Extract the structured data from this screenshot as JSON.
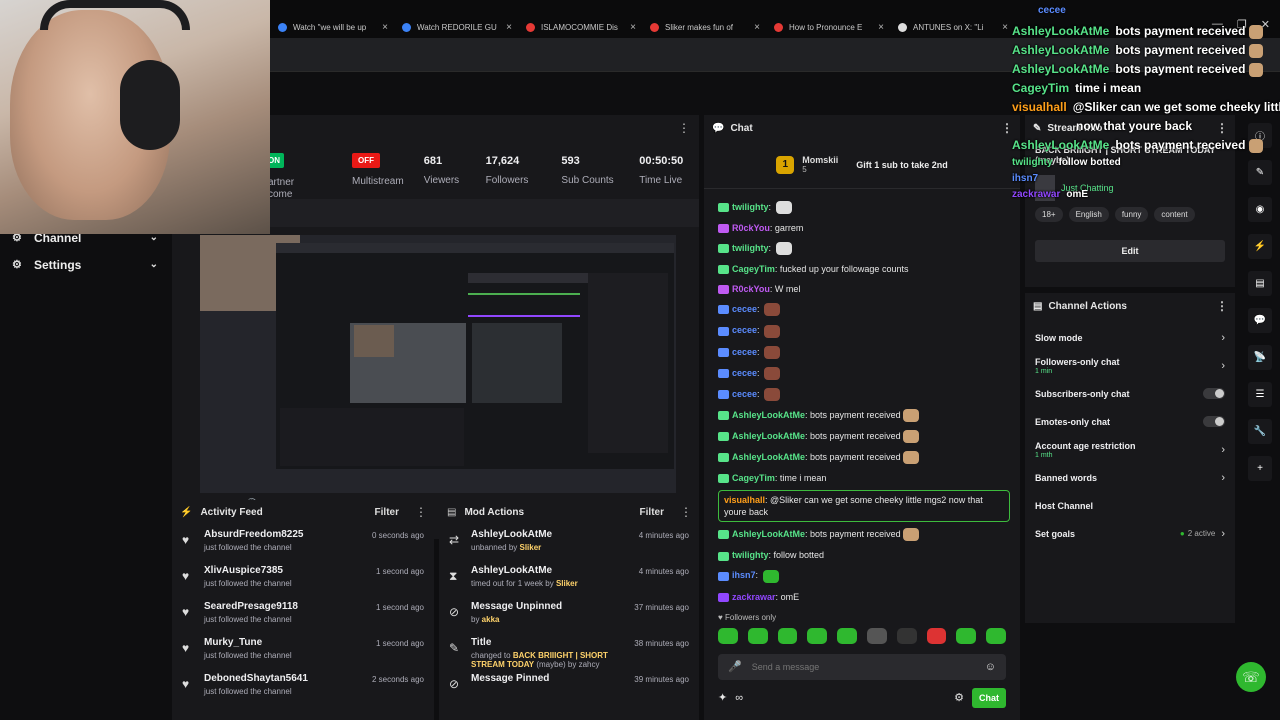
{
  "colors": {
    "accent": "#2fb82f",
    "live": "#00b55a",
    "off": "#e91916",
    "hype": "#d9a400"
  },
  "browser_tabs": [
    {
      "label": "Watch \"we will be up",
      "color": "#3b82f6"
    },
    {
      "label": "Watch REDORILE GU",
      "color": "#3b82f6"
    },
    {
      "label": "ISLAMOCOMMIE Dis",
      "color": "#e53935"
    },
    {
      "label": "Sliker makes fun of",
      "color": "#e53935"
    },
    {
      "label": "How to Pronounce E",
      "color": "#e53935"
    },
    {
      "label": "ANTUNES on X: \"Li",
      "color": "#dddddd"
    }
  ],
  "sidebar": {
    "items": [
      {
        "icon": "channel-icon",
        "label": "Channel"
      },
      {
        "icon": "gear-icon",
        "label": "Settings"
      }
    ]
  },
  "stats": {
    "partial_badge": "ON",
    "partial_label_1": "artner",
    "partial_label_2": "come",
    "multistream_badge": "OFF",
    "multistream_label": "Multistream",
    "viewers_value": "681",
    "viewers_label": "Viewers",
    "followers_value": "17,624",
    "followers_label": "Followers",
    "subs_value": "593",
    "subs_label": "Sub Counts",
    "time_value": "00:50:50",
    "time_label": "Time Live"
  },
  "activity_feed": {
    "title": "Activity Feed",
    "filter_label": "Filter",
    "items": [
      {
        "name": "AbsurdFreedom8225",
        "sub": "just followed the channel",
        "time": "0 seconds ago"
      },
      {
        "name": "XlivAuspice7385",
        "sub": "just followed the channel",
        "time": "1 second ago"
      },
      {
        "name": "SearedPresage9118",
        "sub": "just followed the channel",
        "time": "1 second ago"
      },
      {
        "name": "Murky_Tune",
        "sub": "just followed the channel",
        "time": "1 second ago"
      },
      {
        "name": "DebonedShaytan5641",
        "sub": "just followed the channel",
        "time": "2 seconds ago"
      }
    ]
  },
  "mod_actions": {
    "title": "Mod Actions",
    "filter_label": "Filter",
    "items": [
      {
        "icon": "unban-icon",
        "name": "AshleyLookAtMe",
        "sub_pre": "unbanned by ",
        "sub_hl": "Sliker",
        "sub_post": "",
        "time": "4 minutes ago"
      },
      {
        "icon": "hourglass-icon",
        "name": "AshleyLookAtMe",
        "sub_pre": "timed out for 1 week by ",
        "sub_hl": "Sliker",
        "sub_post": "",
        "time": "4 minutes ago"
      },
      {
        "icon": "pin-icon",
        "name": "Message Unpinned",
        "sub_pre": "by ",
        "sub_hl": "akka",
        "sub_post": "",
        "time": "37 minutes ago"
      },
      {
        "icon": "title-icon",
        "name": "Title",
        "sub_pre": "changed to ",
        "sub_hl": "BACK BRIIIGHT | SHORT STREAM TODAY",
        "sub_post": " (maybe) by zahcy",
        "time": "38 minutes ago"
      },
      {
        "icon": "pin-icon",
        "name": "Message Pinned",
        "sub_pre": "",
        "sub_hl": "",
        "sub_post": "",
        "time": "39 minutes ago"
      }
    ]
  },
  "chat": {
    "title": "Chat",
    "hype_rank": "1",
    "hype_name": "Momskii",
    "hype_count": "5",
    "hype_gift": "Gift 1 sub to take 2nd",
    "messages": [
      {
        "user": "twilighty",
        "color": "#57e389",
        "text": "",
        "emote": "#dddddd"
      },
      {
        "user": "R0ckYou",
        "color": "#bf5af2",
        "text": "garrem",
        "emote": ""
      },
      {
        "user": "twilighty",
        "color": "#57e389",
        "text": "",
        "emote": "#dddddd"
      },
      {
        "user": "CageyTim",
        "color": "#57e389",
        "text": "fucked up your followage counts",
        "emote": ""
      },
      {
        "user": "R0ckYou",
        "color": "#bf5af2",
        "text": "W mel",
        "emote": ""
      },
      {
        "user": "cecee",
        "color": "#5b8cff",
        "text": "",
        "emote": "#8a4a3a"
      },
      {
        "user": "cecee",
        "color": "#5b8cff",
        "text": "",
        "emote": "#8a4a3a"
      },
      {
        "user": "cecee",
        "color": "#5b8cff",
        "text": "",
        "emote": "#8a4a3a"
      },
      {
        "user": "cecee",
        "color": "#5b8cff",
        "text": "",
        "emote": "#8a4a3a"
      },
      {
        "user": "cecee",
        "color": "#5b8cff",
        "text": "",
        "emote": "#8a4a3a"
      },
      {
        "user": "AshleyLookAtMe",
        "color": "#57e389",
        "text": "bots payment received",
        "emote": "#c9a074"
      },
      {
        "user": "AshleyLookAtMe",
        "color": "#57e389",
        "text": "bots payment received",
        "emote": "#c9a074"
      },
      {
        "user": "AshleyLookAtMe",
        "color": "#57e389",
        "text": "bots payment received",
        "emote": "#c9a074"
      },
      {
        "user": "CageyTim",
        "color": "#57e389",
        "text": "time i mean",
        "emote": ""
      }
    ],
    "highlight": {
      "user": "visualhall",
      "text": "@Sliker can we get some cheeky little mgs2 now that youre back"
    },
    "messages2": [
      {
        "user": "AshleyLookAtMe",
        "color": "#57e389",
        "text": "bots payment received",
        "emote": "#c9a074"
      },
      {
        "user": "twilighty",
        "color": "#57e389",
        "text": "follow botted",
        "emote": ""
      },
      {
        "user": "ihsn7",
        "color": "#5b8cff",
        "text": "",
        "emote": "#2fb82f"
      },
      {
        "user": "zackrawar",
        "color": "#9147ff",
        "text": "omE",
        "emote": ""
      }
    ],
    "followers_only": "Followers only",
    "input_placeholder": "Send a message",
    "chat_button": "Chat"
  },
  "stream_info": {
    "title": "Stream Info",
    "stream_title": "BACK BRIIIGHT | SHORT STREAM TODAY (maybe)",
    "category": "Just Chatting",
    "tags": [
      "18+",
      "English",
      "funny",
      "content"
    ],
    "edit_label": "Edit"
  },
  "channel_actions": {
    "title": "Channel Actions",
    "items": [
      {
        "label": "Slow mode",
        "sub": "",
        "control": "chevron"
      },
      {
        "label": "Followers-only chat",
        "sub": "1 min",
        "control": "chevron"
      },
      {
        "label": "Subscribers-only chat",
        "sub": "",
        "control": "toggle"
      },
      {
        "label": "Emotes-only chat",
        "sub": "",
        "control": "toggle"
      },
      {
        "label": "Account age restriction",
        "sub": "1 mth",
        "control": "chevron"
      },
      {
        "label": "Banned words",
        "sub": "",
        "control": "chevron"
      },
      {
        "label": "Host Channel",
        "sub": "",
        "control": "none"
      },
      {
        "label": "Set goals",
        "sub": "",
        "control": "goals"
      }
    ],
    "goals_status": "2 active"
  },
  "overlay": {
    "top_user": "cecee",
    "lines": [
      {
        "user": "AshleyLookAtMe",
        "color": "#57e389",
        "text": "bots payment received"
      },
      {
        "user": "AshleyLookAtMe",
        "color": "#57e389",
        "text": "bots payment received"
      },
      {
        "user": "AshleyLookAtMe",
        "color": "#57e389",
        "text": "bots payment received"
      },
      {
        "user": "CageyTim",
        "color": "#57e389",
        "text": "time i mean"
      },
      {
        "user": "visualhall",
        "color": "#ff9f1a",
        "text": "@Sliker can we get some cheeky little"
      },
      {
        "user": "",
        "color": "#ffffff",
        "text": "now that youre back"
      },
      {
        "user": "AshleyLookAtMe",
        "color": "#57e389",
        "text": "bots payment received"
      },
      {
        "user": "twilighty",
        "color": "#57e389",
        "text": "follow botted"
      },
      {
        "user": "ihsn7",
        "color": "#5b8cff",
        "text": ""
      },
      {
        "user": "zackrawar",
        "color": "#9147ff",
        "text": "omE"
      }
    ]
  }
}
